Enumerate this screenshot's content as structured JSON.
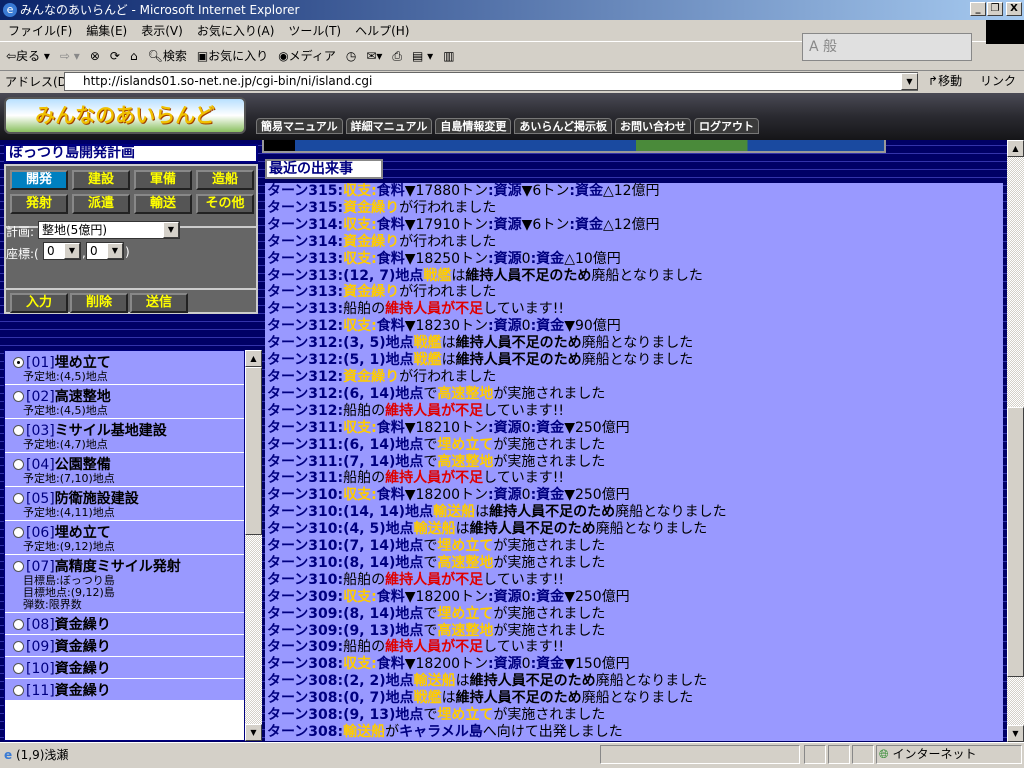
{
  "window": {
    "title": "みんなのあいらんど - Microsoft Internet Explorer"
  },
  "menu": [
    "ファイル(F)",
    "編集(E)",
    "表示(V)",
    "お気に入り(A)",
    "ツール(T)",
    "ヘルプ(H)"
  ],
  "toolbar": {
    "back": "戻る",
    "search": "検索",
    "favorites": "お気に入り",
    "media": "メディア"
  },
  "ime": "A 般",
  "address": {
    "label": "アドレス(D)",
    "url": "http://islands01.so-net.ne.jp/cgi-bin/ni/island.cgi",
    "go": "移動",
    "links": "リンク »"
  },
  "site": {
    "logo": "みんなのあいらんど",
    "nav": [
      "簡易マニュアル",
      "詳細マニュアル",
      "自島情報変更",
      "あいらんど掲示板",
      "お問い合わせ",
      "ログアウト"
    ]
  },
  "plan": {
    "title": "ぼっつり島開発計画",
    "categories": [
      "開発",
      "建設",
      "軍備",
      "造船",
      "発射",
      "派遣",
      "輸送",
      "その他"
    ],
    "active_category": "開発",
    "plan_label": "計画:",
    "plan_value": "整地(5億円)",
    "coord_label": "座標:(",
    "coord_x": "0",
    "coord_sep": ",",
    "coord_y": "0",
    "coord_end": ")",
    "buttons": [
      "入力",
      "削除",
      "送信"
    ],
    "items": [
      {
        "num": "[01]",
        "name": "埋め立て",
        "details": [
          "予定地:(4,5)地点"
        ],
        "selected": true
      },
      {
        "num": "[02]",
        "name": "高速整地",
        "details": [
          "予定地:(4,5)地点"
        ]
      },
      {
        "num": "[03]",
        "name": "ミサイル基地建設",
        "details": [
          "予定地:(4,7)地点"
        ]
      },
      {
        "num": "[04]",
        "name": "公園整備",
        "details": [
          "予定地:(7,10)地点"
        ]
      },
      {
        "num": "[05]",
        "name": "防衛施設建設",
        "details": [
          "予定地:(4,11)地点"
        ]
      },
      {
        "num": "[06]",
        "name": "埋め立て",
        "details": [
          "予定地:(9,12)地点"
        ]
      },
      {
        "num": "[07]",
        "name": "高精度ミサイル発射",
        "details": [
          "目標島:ぼっつり島",
          "目標地点:(9,12)島",
          "弾数:限界数"
        ]
      },
      {
        "num": "[08]",
        "name": "資金繰り",
        "details": []
      },
      {
        "num": "[09]",
        "name": "資金繰り",
        "details": []
      },
      {
        "num": "[10]",
        "name": "資金繰り",
        "details": []
      },
      {
        "num": "[11]",
        "name": "資金繰り",
        "details": []
      }
    ]
  },
  "events": {
    "title": "最近の出来事",
    "lines": [
      [
        [
          "t",
          "ターン315:"
        ],
        [
          "y",
          "収支:"
        ],
        [
          "n",
          "食料"
        ],
        [
          "k",
          "▼17880トン"
        ],
        [
          "n",
          ":資源"
        ],
        [
          "k",
          "▼6トン"
        ],
        [
          "n",
          ":資金"
        ],
        [
          "k",
          "△12億円"
        ]
      ],
      [
        [
          "t",
          "ターン315:"
        ],
        [
          "y",
          "資金繰り"
        ],
        [
          "k",
          "が行われました"
        ]
      ],
      [
        [
          "t",
          "ターン314:"
        ],
        [
          "y",
          "収支:"
        ],
        [
          "n",
          "食料"
        ],
        [
          "k",
          "▼17910トン"
        ],
        [
          "n",
          ":資源"
        ],
        [
          "k",
          "▼6トン"
        ],
        [
          "n",
          ":資金"
        ],
        [
          "k",
          "△12億円"
        ]
      ],
      [
        [
          "t",
          "ターン314:"
        ],
        [
          "y",
          "資金繰り"
        ],
        [
          "k",
          "が行われました"
        ]
      ],
      [
        [
          "t",
          "ターン313:"
        ],
        [
          "y",
          "収支:"
        ],
        [
          "n",
          "食料"
        ],
        [
          "k",
          "▼18250トン"
        ],
        [
          "n",
          ":資源"
        ],
        [
          "k",
          "0"
        ],
        [
          "n",
          ":資金"
        ],
        [
          "k",
          "△10億円"
        ]
      ],
      [
        [
          "t",
          "ターン313:"
        ],
        [
          "n",
          "(12, 7)地点"
        ],
        [
          "y",
          "戦艦"
        ],
        [
          "k",
          "は"
        ],
        [
          "b",
          "維持人員不足のため"
        ],
        [
          "k",
          "廃船となりました"
        ]
      ],
      [
        [
          "t",
          "ターン313:"
        ],
        [
          "y",
          "資金繰り"
        ],
        [
          "k",
          "が行われました"
        ]
      ],
      [
        [
          "t",
          "ターン313:"
        ],
        [
          "k",
          "船舶の"
        ],
        [
          "r",
          "維持人員が不足"
        ],
        [
          "k",
          "しています!!"
        ]
      ],
      [
        [
          "t",
          "ターン312:"
        ],
        [
          "y",
          "収支:"
        ],
        [
          "n",
          "食料"
        ],
        [
          "k",
          "▼18230トン"
        ],
        [
          "n",
          ":資源"
        ],
        [
          "k",
          "0"
        ],
        [
          "n",
          ":資金"
        ],
        [
          "k",
          "▼90億円"
        ]
      ],
      [
        [
          "t",
          "ターン312:"
        ],
        [
          "n",
          "(3, 5)地点"
        ],
        [
          "y",
          "戦艦"
        ],
        [
          "k",
          "は"
        ],
        [
          "b",
          "維持人員不足のため"
        ],
        [
          "k",
          "廃船となりました"
        ]
      ],
      [
        [
          "t",
          "ターン312:"
        ],
        [
          "n",
          "(5, 1)地点"
        ],
        [
          "y",
          "戦艦"
        ],
        [
          "k",
          "は"
        ],
        [
          "b",
          "維持人員不足のため"
        ],
        [
          "k",
          "廃船となりました"
        ]
      ],
      [
        [
          "t",
          "ターン312:"
        ],
        [
          "y",
          "資金繰り"
        ],
        [
          "k",
          "が行われました"
        ]
      ],
      [
        [
          "t",
          "ターン312:"
        ],
        [
          "n",
          "(6, 14)地点"
        ],
        [
          "k",
          "で"
        ],
        [
          "y",
          "高速整地"
        ],
        [
          "k",
          "が実施されました"
        ]
      ],
      [
        [
          "t",
          "ターン312:"
        ],
        [
          "k",
          "船舶の"
        ],
        [
          "r",
          "維持人員が不足"
        ],
        [
          "k",
          "しています!!"
        ]
      ],
      [
        [
          "t",
          "ターン311:"
        ],
        [
          "y",
          "収支:"
        ],
        [
          "n",
          "食料"
        ],
        [
          "k",
          "▼18210トン"
        ],
        [
          "n",
          ":資源"
        ],
        [
          "k",
          "0"
        ],
        [
          "n",
          ":資金"
        ],
        [
          "k",
          "▼250億円"
        ]
      ],
      [
        [
          "t",
          "ターン311:"
        ],
        [
          "n",
          "(6, 14)地点"
        ],
        [
          "k",
          "で"
        ],
        [
          "y",
          "埋め立て"
        ],
        [
          "k",
          "が実施されました"
        ]
      ],
      [
        [
          "t",
          "ターン311:"
        ],
        [
          "n",
          "(7, 14)地点"
        ],
        [
          "k",
          "で"
        ],
        [
          "y",
          "高速整地"
        ],
        [
          "k",
          "が実施されました"
        ]
      ],
      [
        [
          "t",
          "ターン311:"
        ],
        [
          "k",
          "船舶の"
        ],
        [
          "r",
          "維持人員が不足"
        ],
        [
          "k",
          "しています!!"
        ]
      ],
      [
        [
          "t",
          "ターン310:"
        ],
        [
          "y",
          "収支:"
        ],
        [
          "n",
          "食料"
        ],
        [
          "k",
          "▼18200トン"
        ],
        [
          "n",
          ":資源"
        ],
        [
          "k",
          "0"
        ],
        [
          "n",
          ":資金"
        ],
        [
          "k",
          "▼250億円"
        ]
      ],
      [
        [
          "t",
          "ターン310:"
        ],
        [
          "n",
          "(14, 14)地点"
        ],
        [
          "y",
          "輸送船"
        ],
        [
          "k",
          "は"
        ],
        [
          "b",
          "維持人員不足のため"
        ],
        [
          "k",
          "廃船となりました"
        ]
      ],
      [
        [
          "t",
          "ターン310:"
        ],
        [
          "n",
          "(4, 5)地点"
        ],
        [
          "y",
          "輸送船"
        ],
        [
          "k",
          "は"
        ],
        [
          "b",
          "維持人員不足のため"
        ],
        [
          "k",
          "廃船となりました"
        ]
      ],
      [
        [
          "t",
          "ターン310:"
        ],
        [
          "n",
          "(7, 14)地点"
        ],
        [
          "k",
          "で"
        ],
        [
          "y",
          "埋め立て"
        ],
        [
          "k",
          "が実施されました"
        ]
      ],
      [
        [
          "t",
          "ターン310:"
        ],
        [
          "n",
          "(8, 14)地点"
        ],
        [
          "k",
          "で"
        ],
        [
          "y",
          "高速整地"
        ],
        [
          "k",
          "が実施されました"
        ]
      ],
      [
        [
          "t",
          "ターン310:"
        ],
        [
          "k",
          "船舶の"
        ],
        [
          "r",
          "維持人員が不足"
        ],
        [
          "k",
          "しています!!"
        ]
      ],
      [
        [
          "t",
          "ターン309:"
        ],
        [
          "y",
          "収支:"
        ],
        [
          "n",
          "食料"
        ],
        [
          "k",
          "▼18200トン"
        ],
        [
          "n",
          ":資源"
        ],
        [
          "k",
          "0"
        ],
        [
          "n",
          ":資金"
        ],
        [
          "k",
          "▼250億円"
        ]
      ],
      [
        [
          "t",
          "ターン309:"
        ],
        [
          "n",
          "(8, 14)地点"
        ],
        [
          "k",
          "で"
        ],
        [
          "y",
          "埋め立て"
        ],
        [
          "k",
          "が実施されました"
        ]
      ],
      [
        [
          "t",
          "ターン309:"
        ],
        [
          "n",
          "(9, 13)地点"
        ],
        [
          "k",
          "で"
        ],
        [
          "y",
          "高速整地"
        ],
        [
          "k",
          "が実施されました"
        ]
      ],
      [
        [
          "t",
          "ターン309:"
        ],
        [
          "k",
          "船舶の"
        ],
        [
          "r",
          "維持人員が不足"
        ],
        [
          "k",
          "しています!!"
        ]
      ],
      [
        [
          "t",
          "ターン308:"
        ],
        [
          "y",
          "収支:"
        ],
        [
          "n",
          "食料"
        ],
        [
          "k",
          "▼18200トン"
        ],
        [
          "n",
          ":資源"
        ],
        [
          "k",
          "0"
        ],
        [
          "n",
          ":資金"
        ],
        [
          "k",
          "▼150億円"
        ]
      ],
      [
        [
          "t",
          "ターン308:"
        ],
        [
          "n",
          "(2, 2)地点"
        ],
        [
          "y",
          "輸送船"
        ],
        [
          "k",
          "は"
        ],
        [
          "b",
          "維持人員不足のため"
        ],
        [
          "k",
          "廃船となりました"
        ]
      ],
      [
        [
          "t",
          "ターン308:"
        ],
        [
          "n",
          "(0, 7)地点"
        ],
        [
          "y",
          "戦艦"
        ],
        [
          "k",
          "は"
        ],
        [
          "b",
          "維持人員不足のため"
        ],
        [
          "k",
          "廃船となりました"
        ]
      ],
      [
        [
          "t",
          "ターン308:"
        ],
        [
          "n",
          "(9, 13)地点"
        ],
        [
          "k",
          "で"
        ],
        [
          "y",
          "埋め立て"
        ],
        [
          "k",
          "が実施されました"
        ]
      ],
      [
        [
          "t",
          "ターン308:"
        ],
        [
          "y",
          "輸送船"
        ],
        [
          "k",
          "が"
        ],
        [
          "n",
          "キャラメル島"
        ],
        [
          "k",
          "へ向けて出発しました"
        ]
      ]
    ]
  },
  "status": {
    "text": "(1,9)浅瀬",
    "zone": "インターネット"
  },
  "colors": {
    "log_bg": "#9999ff",
    "navy": "#000080",
    "yellow": "#ffcc00",
    "red": "#e00000"
  }
}
